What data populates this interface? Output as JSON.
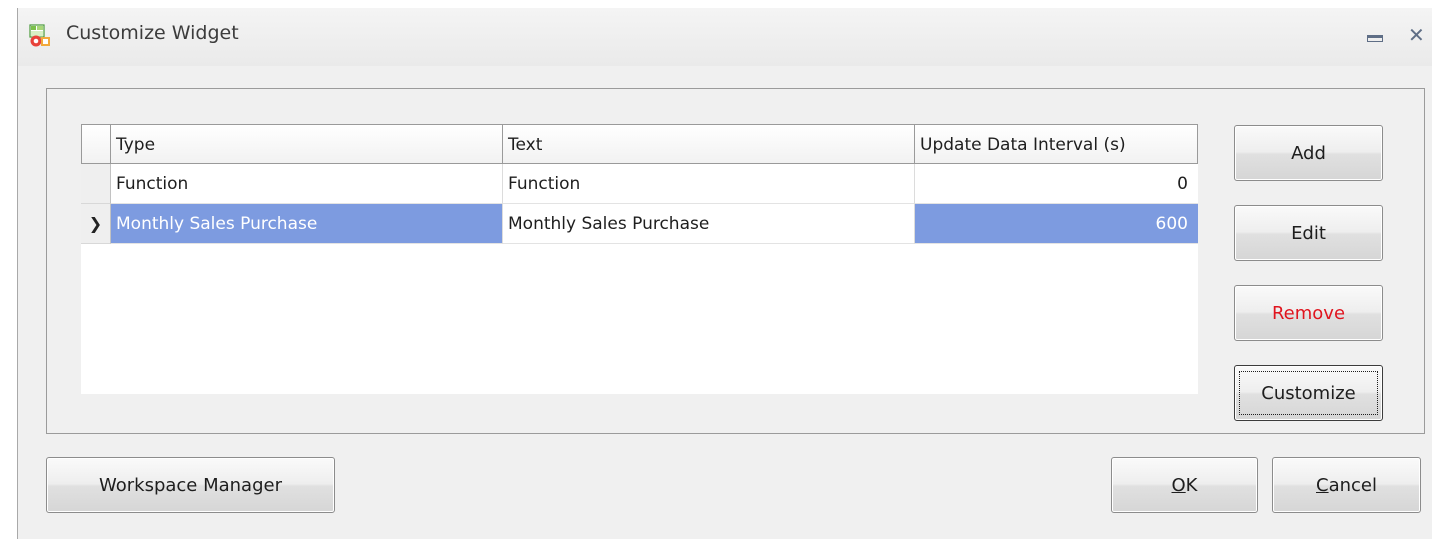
{
  "window": {
    "title": "Customize Widget",
    "icon": "widget-app-icon",
    "title_buttons": [
      "minimize-icon",
      "close-icon"
    ]
  },
  "grid": {
    "columns": [
      "Type",
      "Text",
      "Update Data Interval (s)"
    ],
    "rows": [
      {
        "type": "Function",
        "text": "Function",
        "interval": "0",
        "selected": false
      },
      {
        "type": "Monthly Sales Purchase",
        "text": "Monthly Sales Purchase",
        "interval": "600",
        "selected": true
      }
    ],
    "current_row_indicator": "chevron-right-icon",
    "selection_color": "#7d9be0"
  },
  "side_buttons": {
    "add": "Add",
    "edit": "Edit",
    "remove": "Remove",
    "customize": "Customize"
  },
  "bottom_buttons": {
    "workspace_manager": "Workspace Manager",
    "ok_mnemonic": "O",
    "ok_rest": "K",
    "cancel_mnemonic": "C",
    "cancel_rest": "ancel"
  },
  "colors": {
    "remove_text": "#e0141e",
    "window_bg": "#f0f0f0"
  }
}
